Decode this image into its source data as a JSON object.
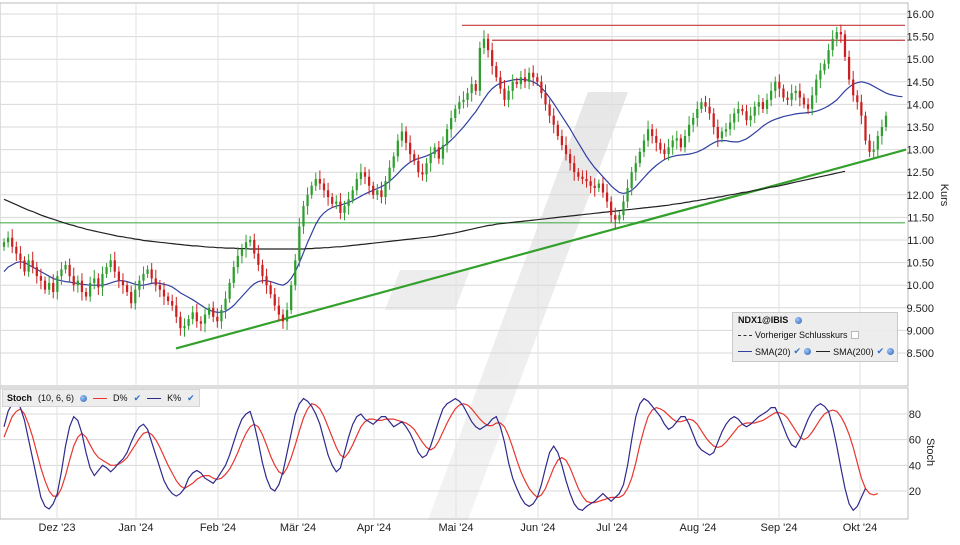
{
  "colors": {
    "candle_up": "#2e9e2e",
    "candle_down": "#cc1f1f",
    "sma20": "#303fa0",
    "sma200": "#222222",
    "resistance": "#c23b3b",
    "support_line": "#33a02c",
    "support_horizontal": "#4caf50",
    "stoch_d": "#e8362f",
    "stoch_k": "#2e2a8c",
    "grid": "#d8d8d8"
  },
  "price_panel": {
    "y_axis_label": "Kurs",
    "y_ticks": [
      "8.500",
      "9.000",
      "9.500",
      "10.00",
      "10.50",
      "11.00",
      "11.50",
      "12.00",
      "12.50",
      "13.00",
      "13.50",
      "14.00",
      "14.50",
      "15.00",
      "15.50",
      "16.00"
    ],
    "legend": {
      "title": "NDX1@IBIS",
      "previous_close_label": "Vorheriger Schlusskurs",
      "sma20_label": "SMA(20)",
      "sma200_label": "SMA(200)"
    }
  },
  "stoch_panel": {
    "name": "Stoch",
    "params": "(10, 6, 6)",
    "d_label": "D%",
    "k_label": "K%",
    "y_axis_label": "Stoch",
    "y_ticks": [
      "20",
      "40",
      "60",
      "80"
    ]
  },
  "x_ticks": [
    "Dez '23",
    "Jan '24",
    "Feb '24",
    "Mär '24",
    "Apr '24",
    "Mai '24",
    "Jun '24",
    "Jul '24",
    "Aug '24",
    "Sep '24",
    "Okt '24"
  ],
  "chart_data": [
    {
      "type": "candlestick",
      "ylim": [
        8.2,
        16.25
      ],
      "grid": true,
      "legend_position": "bottom-right",
      "closes": [
        10.95,
        11.05,
        10.85,
        10.7,
        10.55,
        10.3,
        10.55,
        10.4,
        10.2,
        10.1,
        9.9,
        10.05,
        9.85,
        10.2,
        10.35,
        10.45,
        10.2,
        10.0,
        10.1,
        9.85,
        9.75,
        10.05,
        10.15,
        9.95,
        10.25,
        10.4,
        10.55,
        10.3,
        10.1,
        10.0,
        9.85,
        9.6,
        9.9,
        10.1,
        10.25,
        10.35,
        10.15,
        10.0,
        9.9,
        9.75,
        9.65,
        9.55,
        9.3,
        9.05,
        9.1,
        9.25,
        9.4,
        9.2,
        9.15,
        9.35,
        9.5,
        9.3,
        9.2,
        9.45,
        9.7,
        10.05,
        10.4,
        10.65,
        10.8,
        10.95,
        11.0,
        10.7,
        10.45,
        10.2,
        10.0,
        9.8,
        9.55,
        9.35,
        9.2,
        9.45,
        10.0,
        10.55,
        11.3,
        11.75,
        12.0,
        12.2,
        12.35,
        12.25,
        12.1,
        11.95,
        11.8,
        11.85,
        11.6,
        11.75,
        11.9,
        12.1,
        12.35,
        12.5,
        12.4,
        12.2,
        12.0,
        12.1,
        11.95,
        12.3,
        12.6,
        12.85,
        13.2,
        13.4,
        13.15,
        12.9,
        12.75,
        12.5,
        12.45,
        12.7,
        12.9,
        13.05,
        12.8,
        13.1,
        13.45,
        13.7,
        13.9,
        14.05,
        14.1,
        14.25,
        14.45,
        14.3,
        15.25,
        15.45,
        15.2,
        14.85,
        14.6,
        14.35,
        14.1,
        14.3,
        14.5,
        14.45,
        14.6,
        14.5,
        14.7,
        14.6,
        14.5,
        14.25,
        14.0,
        13.75,
        13.55,
        13.3,
        13.1,
        12.9,
        12.7,
        12.5,
        12.4,
        12.35,
        12.3,
        12.2,
        12.15,
        12.25,
        12.05,
        11.85,
        11.55,
        11.45,
        11.55,
        11.85,
        12.15,
        12.5,
        12.7,
        12.95,
        13.2,
        13.45,
        13.3,
        13.15,
        13.0,
        12.9,
        13.05,
        13.2,
        13.25,
        13.05,
        13.3,
        13.55,
        13.7,
        13.9,
        14.05,
        13.95,
        13.8,
        13.5,
        13.25,
        13.4,
        13.45,
        13.6,
        13.8,
        13.9,
        13.85,
        13.65,
        13.75,
        13.95,
        14.05,
        13.9,
        14.1,
        14.3,
        14.5,
        14.35,
        14.15,
        14.1,
        14.25,
        14.3,
        14.15,
        14.0,
        13.9,
        14.2,
        14.55,
        14.75,
        14.9,
        15.2,
        15.45,
        15.6,
        15.55,
        15.05,
        14.55,
        14.2,
        14.05,
        13.75,
        13.2,
        12.95,
        13.0,
        13.3,
        13.5,
        13.75
      ]
    },
    {
      "type": "line",
      "series": [
        {
          "name": "SMA(20)",
          "values": [
            10.3,
            10.4,
            10.45,
            10.5,
            10.52,
            10.5,
            10.45,
            10.4,
            10.35,
            10.3,
            10.25,
            10.2,
            10.15,
            10.12,
            10.1,
            10.08,
            10.07,
            10.05,
            10.04,
            10.02,
            10.01,
            10.0,
            10.0,
            10.0,
            10.0,
            10.02,
            10.05,
            10.08,
            10.1,
            10.1,
            10.08,
            10.05,
            10.02,
            10.0,
            10.0,
            10.02,
            10.04,
            10.05,
            10.04,
            10.02,
            10.0,
            9.96,
            9.9,
            9.83,
            9.78,
            9.73,
            9.68,
            9.62,
            9.56,
            9.5,
            9.45,
            9.42,
            9.4,
            9.4,
            9.42,
            9.48,
            9.55,
            9.65,
            9.75,
            9.85,
            9.95,
            10.03,
            10.08,
            10.1,
            10.1,
            10.08,
            10.05,
            10.02,
            10.0,
            10.05,
            10.15,
            10.3,
            10.5,
            10.72,
            10.95,
            11.15,
            11.35,
            11.5,
            11.6,
            11.67,
            11.72,
            11.75,
            11.77,
            11.8,
            11.83,
            11.87,
            11.92,
            11.97,
            12.02,
            12.06,
            12.1,
            12.14,
            12.18,
            12.23,
            12.3,
            12.38,
            12.47,
            12.57,
            12.65,
            12.72,
            12.77,
            12.8,
            12.83,
            12.86,
            12.9,
            12.95,
            13.0,
            13.06,
            13.13,
            13.21,
            13.3,
            13.4,
            13.5,
            13.61,
            13.73,
            13.84,
            13.98,
            14.12,
            14.25,
            14.35,
            14.42,
            14.47,
            14.5,
            14.52,
            14.54,
            14.55,
            14.55,
            14.55,
            14.53,
            14.5,
            14.45,
            14.37,
            14.27,
            14.15,
            14.02,
            13.88,
            13.74,
            13.6,
            13.46,
            13.3,
            13.15,
            13.0,
            12.85,
            12.72,
            12.6,
            12.5,
            12.4,
            12.3,
            12.2,
            12.12,
            12.05,
            12.03,
            12.05,
            12.1,
            12.18,
            12.28,
            12.38,
            12.48,
            12.57,
            12.65,
            12.72,
            12.78,
            12.82,
            12.85,
            12.87,
            12.88,
            12.89,
            12.9,
            12.92,
            12.95,
            12.99,
            13.04,
            13.1,
            13.15,
            13.19,
            13.2,
            13.2,
            13.18,
            13.17,
            13.17,
            13.2,
            13.24,
            13.3,
            13.37,
            13.44,
            13.52,
            13.58,
            13.63,
            13.67,
            13.7,
            13.73,
            13.75,
            13.77,
            13.79,
            13.8,
            13.81,
            13.82,
            13.83,
            13.85,
            13.88,
            13.92,
            13.97,
            14.03,
            14.1,
            14.2,
            14.3,
            14.38,
            14.45,
            14.48,
            14.5,
            14.48,
            14.45,
            14.4,
            14.35,
            14.3,
            14.25,
            14.22,
            14.2,
            14.18,
            14.17
          ]
        },
        {
          "name": "SMA(200)",
          "values": [
            11.9,
            11.86,
            11.82,
            11.78,
            11.74,
            11.7,
            11.66,
            11.63,
            11.59,
            11.55,
            11.52,
            11.49,
            11.46,
            11.43,
            11.4,
            11.37,
            11.34,
            11.32,
            11.29,
            11.27,
            11.24,
            11.22,
            11.2,
            11.18,
            11.16,
            11.14,
            11.12,
            11.1,
            11.08,
            11.07,
            11.05,
            11.04,
            11.02,
            11.01,
            10.99,
            10.98,
            10.97,
            10.96,
            10.95,
            10.94,
            10.93,
            10.92,
            10.91,
            10.9,
            10.89,
            10.88,
            10.87,
            10.87,
            10.86,
            10.85,
            10.84,
            10.84,
            10.83,
            10.83,
            10.82,
            10.82,
            10.82,
            10.81,
            10.81,
            10.81,
            10.8,
            10.8,
            10.8,
            10.8,
            10.8,
            10.8,
            10.8,
            10.8,
            10.8,
            10.8,
            10.8,
            10.8,
            10.8,
            10.8,
            10.81,
            10.81,
            10.82,
            10.82,
            10.83,
            10.83,
            10.84,
            10.85,
            10.85,
            10.86,
            10.87,
            10.88,
            10.89,
            10.9,
            10.91,
            10.92,
            10.93,
            10.94,
            10.95,
            10.96,
            10.97,
            10.98,
            10.99,
            11.0,
            11.01,
            11.02,
            11.03,
            11.04,
            11.05,
            11.06,
            11.07,
            11.08,
            11.1,
            11.11,
            11.13,
            11.14,
            11.16,
            11.18,
            11.2,
            11.22,
            11.24,
            11.26,
            11.28,
            11.3,
            11.32,
            11.33,
            11.35,
            11.36,
            11.37,
            11.38,
            11.39,
            11.4,
            11.41,
            11.42,
            11.43,
            11.44,
            11.45,
            11.46,
            11.47,
            11.48,
            11.49,
            11.5,
            11.51,
            11.52,
            11.53,
            11.54,
            11.55,
            11.56,
            11.57,
            11.58,
            11.59,
            11.6,
            11.61,
            11.62,
            11.63,
            11.64,
            11.65,
            11.66,
            11.67,
            11.68,
            11.69,
            11.7,
            11.71,
            11.72,
            11.73,
            11.74,
            11.75,
            11.76,
            11.77,
            11.79,
            11.8,
            11.81,
            11.83,
            11.84,
            11.86,
            11.87,
            11.89,
            11.9,
            11.92,
            11.93,
            11.95,
            11.96,
            11.98,
            12.0,
            12.01,
            12.03,
            12.05,
            12.06,
            12.08,
            12.1,
            12.11,
            12.13,
            12.15,
            12.17,
            12.18,
            12.2,
            12.22,
            12.24,
            12.26,
            12.28,
            12.3,
            12.32,
            12.34,
            12.36,
            12.38,
            12.4,
            12.42,
            12.44,
            12.46,
            12.48,
            12.5,
            12.52
          ]
        }
      ]
    },
    {
      "type": "line",
      "ylim": [
        0,
        100
      ],
      "series": [
        {
          "name": "K%",
          "values": [
            70,
            82,
            88,
            90,
            85,
            75,
            60,
            45,
            30,
            15,
            8,
            6,
            10,
            18,
            35,
            55,
            70,
            78,
            75,
            65,
            50,
            38,
            32,
            36,
            40,
            38,
            35,
            38,
            42,
            45,
            50,
            58,
            65,
            70,
            72,
            68,
            58,
            48,
            38,
            28,
            22,
            18,
            16,
            18,
            22,
            30,
            34,
            36,
            34,
            30,
            28,
            26,
            30,
            35,
            40,
            48,
            58,
            68,
            76,
            80,
            82,
            72,
            58,
            42,
            30,
            22,
            20,
            25,
            35,
            50,
            65,
            80,
            88,
            92,
            90,
            86,
            80,
            72,
            60,
            48,
            40,
            35,
            38,
            50,
            62,
            72,
            78,
            80,
            76,
            74,
            72,
            75,
            78,
            78,
            74,
            70,
            72,
            74,
            70,
            65,
            58,
            50,
            46,
            48,
            55,
            65,
            75,
            84,
            88,
            90,
            92,
            90,
            86,
            80,
            74,
            70,
            68,
            70,
            72,
            76,
            78,
            70,
            58,
            42,
            30,
            22,
            15,
            10,
            8,
            10,
            15,
            25,
            38,
            50,
            55,
            50,
            40,
            28,
            18,
            10,
            6,
            5,
            8,
            10,
            12,
            15,
            18,
            15,
            12,
            15,
            18,
            25,
            40,
            60,
            78,
            88,
            92,
            90,
            86,
            82,
            78,
            72,
            68,
            70,
            74,
            78,
            78,
            72,
            64,
            56,
            52,
            50,
            48,
            50,
            58,
            66,
            72,
            76,
            78,
            76,
            72,
            70,
            72,
            75,
            78,
            80,
            82,
            85,
            85,
            78,
            70,
            62,
            56,
            54,
            60,
            68,
            76,
            82,
            86,
            88,
            86,
            82,
            70,
            55,
            38,
            22,
            10,
            5,
            8,
            15,
            22
          ]
        },
        {
          "name": "D%",
          "values": [
            62,
            70,
            78,
            82,
            84,
            80,
            72,
            62,
            50,
            38,
            28,
            20,
            16,
            16,
            22,
            32,
            44,
            55,
            62,
            65,
            62,
            56,
            50,
            46,
            44,
            42,
            40,
            40,
            41,
            43,
            46,
            51,
            56,
            61,
            65,
            66,
            64,
            60,
            54,
            47,
            40,
            34,
            28,
            24,
            22,
            24,
            26,
            29,
            31,
            32,
            32,
            30,
            29,
            30,
            33,
            37,
            43,
            50,
            58,
            65,
            70,
            72,
            70,
            64,
            56,
            47,
            40,
            35,
            33,
            38,
            46,
            56,
            67,
            77,
            84,
            88,
            87,
            84,
            78,
            70,
            62,
            54,
            48,
            46,
            50,
            56,
            63,
            70,
            74,
            76,
            76,
            75,
            75,
            76,
            76,
            76,
            75,
            74,
            73,
            71,
            68,
            63,
            58,
            54,
            52,
            54,
            59,
            66,
            73,
            79,
            84,
            87,
            88,
            87,
            84,
            80,
            76,
            73,
            71,
            71,
            73,
            73,
            70,
            63,
            54,
            44,
            35,
            28,
            22,
            18,
            15,
            17,
            22,
            30,
            38,
            44,
            46,
            44,
            38,
            30,
            22,
            16,
            12,
            11,
            11,
            12,
            13,
            14,
            15,
            15,
            15,
            17,
            22,
            30,
            42,
            56,
            68,
            78,
            83,
            85,
            84,
            82,
            79,
            76,
            74,
            74,
            75,
            76,
            75,
            72,
            67,
            62,
            58,
            55,
            54,
            55,
            58,
            62,
            66,
            70,
            72,
            73,
            73,
            73,
            74,
            75,
            77,
            79,
            81,
            81,
            80,
            77,
            72,
            67,
            62,
            60,
            62,
            66,
            71,
            76,
            80,
            82,
            83,
            82,
            78,
            72,
            64,
            54,
            42,
            30,
            22,
            18,
            17,
            18
          ]
        }
      ]
    }
  ]
}
